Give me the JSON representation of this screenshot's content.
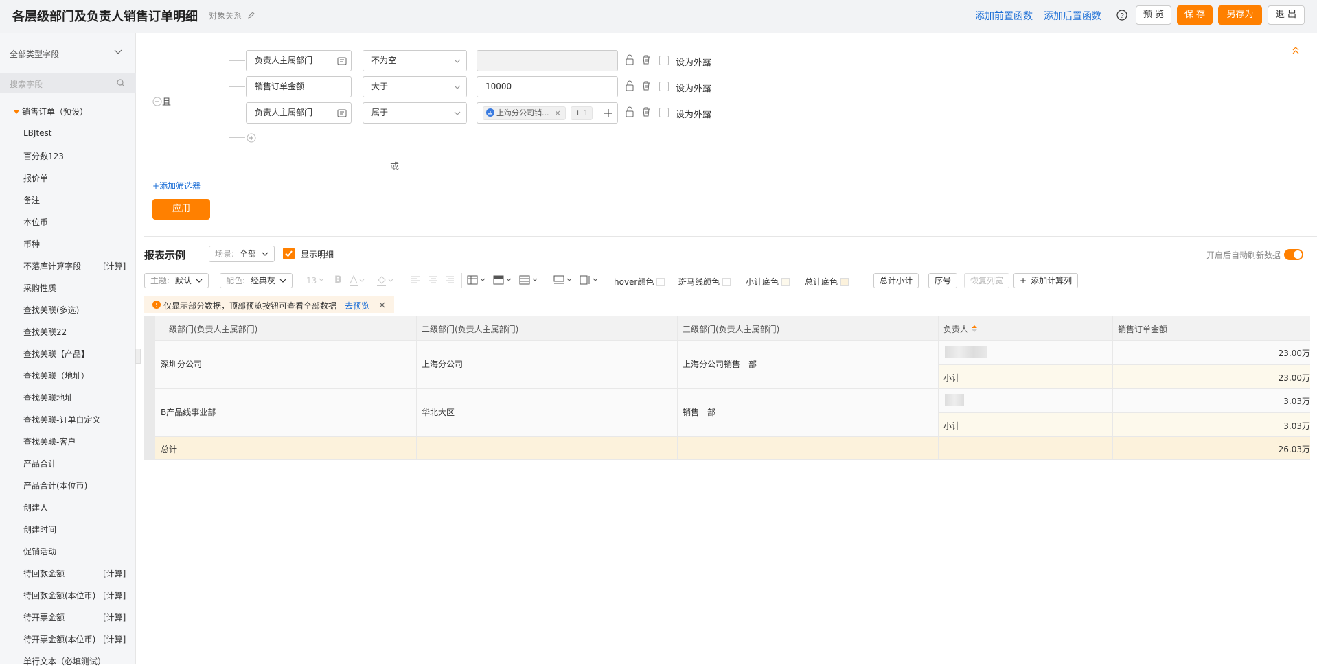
{
  "header": {
    "title": "各层级部门及负责人销售订单明细",
    "object_relation": "对象关系",
    "add_pre_func": "添加前置函数",
    "add_post_func": "添加后置函数",
    "preview": "预 览",
    "save": "保 存",
    "save_as": "另存为",
    "exit": "退 出"
  },
  "sidebar": {
    "type_select": "全部类型字段",
    "search_placeholder": "搜索字段",
    "group": "销售订单（预设）",
    "items": [
      {
        "label": "LBJtest",
        "tag": ""
      },
      {
        "label": "百分数123",
        "tag": ""
      },
      {
        "label": "报价单",
        "tag": ""
      },
      {
        "label": "备注",
        "tag": ""
      },
      {
        "label": "本位币",
        "tag": ""
      },
      {
        "label": "币种",
        "tag": ""
      },
      {
        "label": "不落库计算字段",
        "tag": "[计算]"
      },
      {
        "label": "采购性质",
        "tag": ""
      },
      {
        "label": "查找关联(多选)",
        "tag": ""
      },
      {
        "label": "查找关联22",
        "tag": ""
      },
      {
        "label": "查找关联【产品】",
        "tag": ""
      },
      {
        "label": "查找关联（地址）",
        "tag": ""
      },
      {
        "label": "查找关联地址",
        "tag": ""
      },
      {
        "label": "查找关联-订单自定义",
        "tag": ""
      },
      {
        "label": "查找关联-客户",
        "tag": ""
      },
      {
        "label": "产品合计",
        "tag": ""
      },
      {
        "label": "产品合计(本位币)",
        "tag": ""
      },
      {
        "label": "创建人",
        "tag": ""
      },
      {
        "label": "创建时间",
        "tag": ""
      },
      {
        "label": "促销活动",
        "tag": ""
      },
      {
        "label": "待回款金额",
        "tag": "[计算]"
      },
      {
        "label": "待回款金额(本位币)",
        "tag": "[计算]"
      },
      {
        "label": "待开票金额",
        "tag": "[计算]"
      },
      {
        "label": "待开票金额(本位币)",
        "tag": "[计算]"
      },
      {
        "label": "单行文本（必填测试）",
        "tag": ""
      }
    ]
  },
  "filter": {
    "and_label": "且",
    "or_label": "或",
    "add_filter": "+添加筛选器",
    "apply": "应用",
    "expose_label": "设为外露",
    "rows": [
      {
        "field": "负责人主属部门",
        "operator": "不为空",
        "value": ""
      },
      {
        "field": "销售订单金额",
        "operator": "大于",
        "value": "10000"
      },
      {
        "field": "负责人主属部门",
        "operator": "属于",
        "value": "上海分公司销...",
        "more": "+ 1"
      }
    ]
  },
  "report": {
    "title": "报表示例",
    "scene_label": "场景:",
    "scene_value": "全部",
    "show_detail": "显示明细",
    "auto_refresh": "开启后自动刷新数据",
    "toolbar": {
      "theme_label": "主题:",
      "theme_value": "默认",
      "color_label": "配色:",
      "color_value": "经典灰",
      "font_size": "13",
      "hover_color": "hover颜色",
      "zebra_color": "斑马线颜色",
      "subtotal_bg": "小计底色",
      "total_bg": "总计底色",
      "total_subtotal": "总计小计",
      "index": "序号",
      "restore_width": "恢复列宽",
      "add_calc_col": "添加计算列"
    },
    "notice": "仅显示部分数据，顶部预览按钮可查看全部数据",
    "notice_link": "去预览",
    "columns": [
      "一级部门(负责人主属部门)",
      "二级部门(负责人主属部门)",
      "三级部门(负责人主属部门)",
      "负责人",
      "销售订单金额"
    ],
    "groups": [
      {
        "l1": "深圳分公司",
        "l2": "上海分公司",
        "l3": "上海分公司销售一部",
        "amount": "23.00万",
        "subtotal_label": "小计",
        "subtotal": "23.00万"
      },
      {
        "l1": "B产品线事业部",
        "l2": "华北大区",
        "l3": "销售一部",
        "amount": "3.03万",
        "subtotal_label": "小计",
        "subtotal": "3.03万"
      }
    ],
    "total_label": "总计",
    "total": "26.03万"
  },
  "colors": {
    "accent": "#ff8000",
    "link": "#1d6fd6",
    "subtotal_bg": "#fdf9ec",
    "total_bg": "#fcf2dc"
  }
}
